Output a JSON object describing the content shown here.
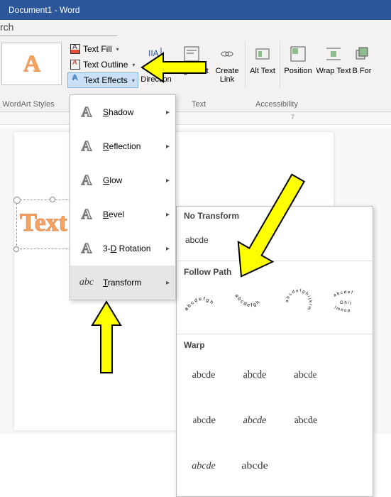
{
  "titlebar": {
    "text": "Document1 - Word"
  },
  "search_fragment": "rch",
  "styles_group": {
    "fill": "Text Fill",
    "outline": "Text Outline",
    "effects": "Text Effects"
  },
  "ribbon_btns": {
    "text_direction": "Text Direction",
    "align_text": "Align Text",
    "create_link": "Create Link",
    "alt_text": "Alt Text",
    "position": "Position",
    "wrap_text": "Wrap Text",
    "bring_forward": "B For"
  },
  "group_labels": {
    "wordart": "WordArt Styles",
    "text": "Text",
    "accessibility": "Accessibility"
  },
  "ruler_num": "7",
  "wordart_sample": "A",
  "wordart_text": "Text",
  "effects_menu": [
    {
      "label": "Shadow",
      "key": "S"
    },
    {
      "label": "Reflection",
      "key": "R"
    },
    {
      "label": "Glow",
      "key": "G"
    },
    {
      "label": "Bevel",
      "key": "B"
    },
    {
      "label": "3-D Rotation",
      "key": "D"
    },
    {
      "label": "Transform",
      "key": "T"
    }
  ],
  "transform": {
    "no_transform": "No Transform",
    "sample": "abcde",
    "follow_path": "Follow Path",
    "warp": "Warp",
    "warp_sample": "abcde"
  }
}
